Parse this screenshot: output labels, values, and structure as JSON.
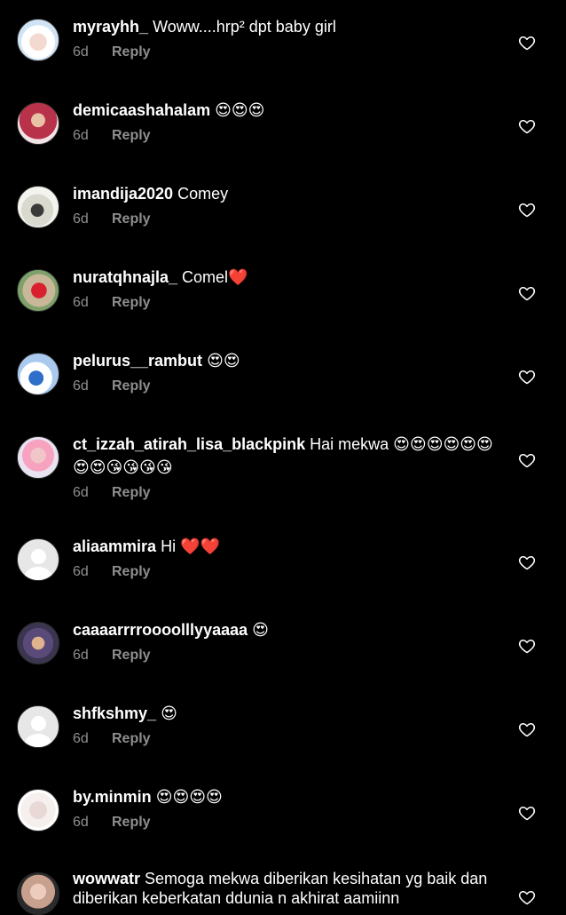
{
  "theme": {
    "background": "#000000",
    "text": "#ffffff",
    "muted": "#8e8e8e"
  },
  "icons": {
    "like": "heart-outline-icon",
    "default_avatar": "default-avatar-icon"
  },
  "comments": [
    {
      "username": "myrayhh_",
      "text": "Woww....hrp² dpt baby girl",
      "age": "6d",
      "reply_label": "Reply"
    },
    {
      "username": "demicaashahalam",
      "text": "😍😍😍",
      "age": "6d",
      "reply_label": "Reply"
    },
    {
      "username": "imandija2020",
      "text": "Comey",
      "age": "6d",
      "reply_label": "Reply"
    },
    {
      "username": "nuratqhnajla_",
      "text": "Comel❤️",
      "age": "6d",
      "reply_label": "Reply"
    },
    {
      "username": "pelurus__rambut",
      "text": "😍😍",
      "age": "6d",
      "reply_label": "Reply"
    },
    {
      "username": "ct_izzah_atirah_lisa_blackpink",
      "text": "Hai mekwa 😍😍😍😍😍😍😍😍😘😘😘😘",
      "age": "6d",
      "reply_label": "Reply"
    },
    {
      "username": "aliaammira",
      "text": "Hi ❤️❤️",
      "age": "6d",
      "reply_label": "Reply"
    },
    {
      "username": "caaaarrrroooolllyyaaaa",
      "text": "😍",
      "age": "6d",
      "reply_label": "Reply"
    },
    {
      "username": "shfkshmy_",
      "text": "😍",
      "age": "6d",
      "reply_label": "Reply"
    },
    {
      "username": "by.minmin",
      "text": "😍😍😍😍",
      "age": "6d",
      "reply_label": "Reply"
    },
    {
      "username": "wowwatr",
      "text": "Semoga mekwa diberikan kesihatan yg baik dan diberikan keberkatan ddunia n akhirat aamiinn",
      "age": "",
      "reply_label": ""
    }
  ]
}
